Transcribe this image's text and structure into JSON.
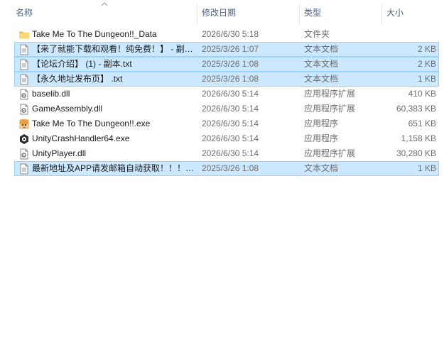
{
  "columns": {
    "name": "名称",
    "date": "修改日期",
    "type": "类型",
    "size": "大小"
  },
  "files": [
    {
      "name": "Take Me To The Dungeon!!_Data",
      "date": "2026/6/30 5:18",
      "type": "文件夹",
      "size": "",
      "icon": "folder-icon",
      "selected": false
    },
    {
      "name": "【来了就能下载和观看！纯免费！】 - 副本.txt",
      "date": "2025/3/26 1:07",
      "type": "文本文档",
      "size": "2 KB",
      "icon": "text-file-icon",
      "selected": true
    },
    {
      "name": "【论坛介绍】 (1) - 副本.txt",
      "date": "2025/3/26 1:08",
      "type": "文本文档",
      "size": "2 KB",
      "icon": "text-file-icon",
      "selected": true
    },
    {
      "name": "【永久地址发布页】 .txt",
      "date": "2025/3/26 1:08",
      "type": "文本文档",
      "size": "1 KB",
      "icon": "text-file-icon",
      "selected": true
    },
    {
      "name": "baselib.dll",
      "date": "2026/6/30 5:14",
      "type": "应用程序扩展",
      "size": "410 KB",
      "icon": "dll-file-icon",
      "selected": false
    },
    {
      "name": "GameAssembly.dll",
      "date": "2026/6/30 5:14",
      "type": "应用程序扩展",
      "size": "60,383 KB",
      "icon": "dll-file-icon",
      "selected": false
    },
    {
      "name": "Take Me To The Dungeon!!.exe",
      "date": "2026/6/30 5:14",
      "type": "应用程序",
      "size": "651 KB",
      "icon": "game-exe-icon",
      "selected": false
    },
    {
      "name": "UnityCrashHandler64.exe",
      "date": "2026/6/30 5:14",
      "type": "应用程序",
      "size": "1,158 KB",
      "icon": "unity-exe-icon",
      "selected": false
    },
    {
      "name": "UnityPlayer.dll",
      "date": "2026/6/30 5:14",
      "type": "应用程序扩展",
      "size": "30,280 KB",
      "icon": "dll-file-icon",
      "selected": false
    },
    {
      "name": "最新地址及APP请发邮箱自动获取！！！.txt",
      "date": "2025/3/26 1:08",
      "type": "文本文档",
      "size": "1 KB",
      "icon": "text-file-icon",
      "selected": true
    }
  ],
  "colors": {
    "selection_bg": "#cce8ff",
    "selection_border": "#99d1ff",
    "header_text": "#4c607a",
    "folder": "#f8d775"
  }
}
